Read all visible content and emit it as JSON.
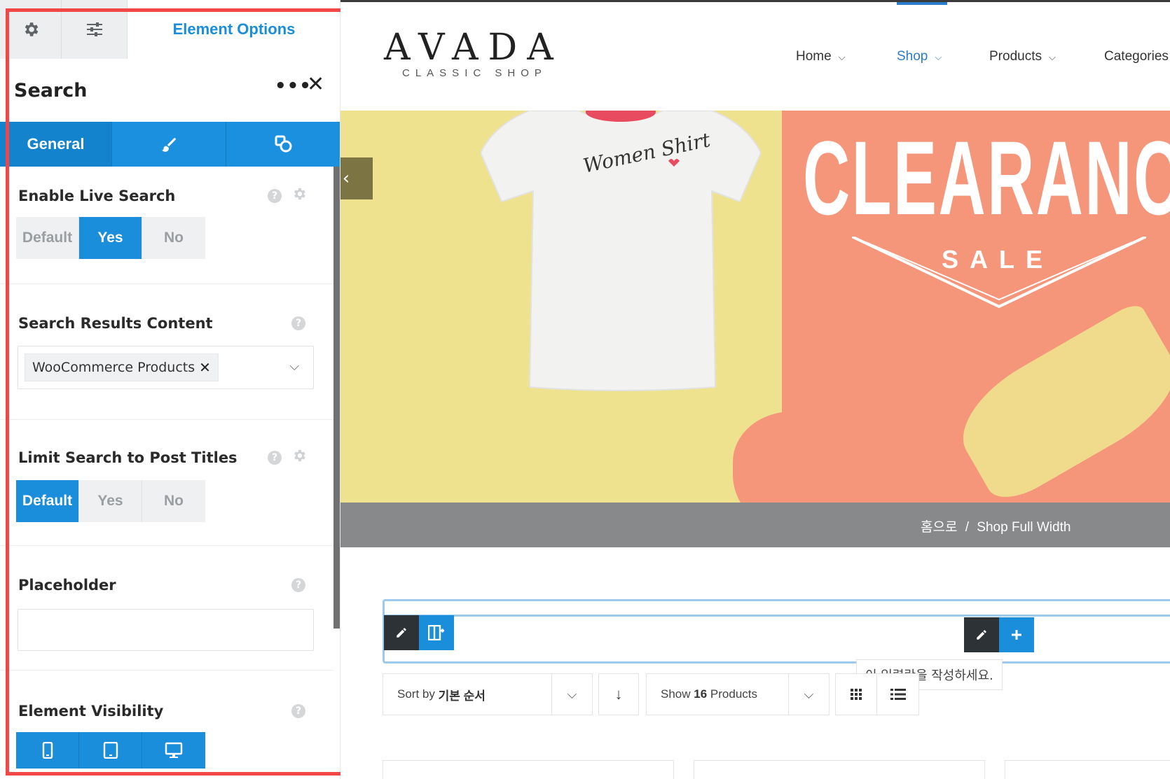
{
  "panel": {
    "tabs": {
      "gear_icon": "gear-icon",
      "sliders_icon": "sliders-icon",
      "options_label": "Element Options"
    },
    "header": {
      "title": "Search",
      "more": "•••",
      "close": "✕"
    },
    "subtabs": {
      "general_label": "General",
      "design_icon": "brush-icon",
      "extras_icon": "shapes-icon"
    },
    "options": {
      "live_search": {
        "label": "Enable Live Search",
        "buttons": [
          "Default",
          "Yes",
          "No"
        ],
        "selected": "Yes"
      },
      "results_content": {
        "label": "Search Results Content",
        "chip": "WooCommerce Products",
        "chip_remove": "✕",
        "arrow": "⌵"
      },
      "limit_titles": {
        "label": "Limit Search to Post Titles",
        "buttons": [
          "Default",
          "Yes",
          "No"
        ],
        "selected": "Default"
      },
      "placeholder": {
        "label": "Placeholder",
        "value": ""
      },
      "visibility": {
        "label": "Element Visibility",
        "devices": [
          "mobile-icon",
          "tablet-icon",
          "desktop-icon"
        ]
      }
    },
    "help": "?"
  },
  "site": {
    "logo": {
      "main": "AVADA",
      "sub": "CLASSIC SHOP"
    },
    "nav": [
      {
        "label": "Home",
        "chev": "⌵"
      },
      {
        "label": "Shop",
        "chev": "⌵"
      },
      {
        "label": "Products",
        "chev": "⌵"
      },
      {
        "label": "Categories",
        "chev": ""
      }
    ],
    "active_nav": "Shop",
    "hero": {
      "headline": "CLEARANC",
      "sub": "SALE",
      "shirt_text": "Women Shirt",
      "arrow": "‹"
    },
    "breadcrumb": {
      "home": "홈으로",
      "sep": "/",
      "current": "Shop Full Width"
    },
    "tooltip": "이 입력란을 작성하세요.",
    "sort": {
      "prefix": "Sort by",
      "value": "기본 순서",
      "arrow": "⌵"
    },
    "direction": "↓",
    "show": {
      "prefix": "Show",
      "count": "16",
      "suffix": "Products",
      "arrow": "⌵"
    },
    "view_grid_icon": "grid-icon",
    "view_list_icon": "list-icon"
  },
  "colors": {
    "accent": "#1a8ddb",
    "frame": "#f14747",
    "hero_yellow": "#efe28f",
    "hero_coral": "#f5957a"
  }
}
